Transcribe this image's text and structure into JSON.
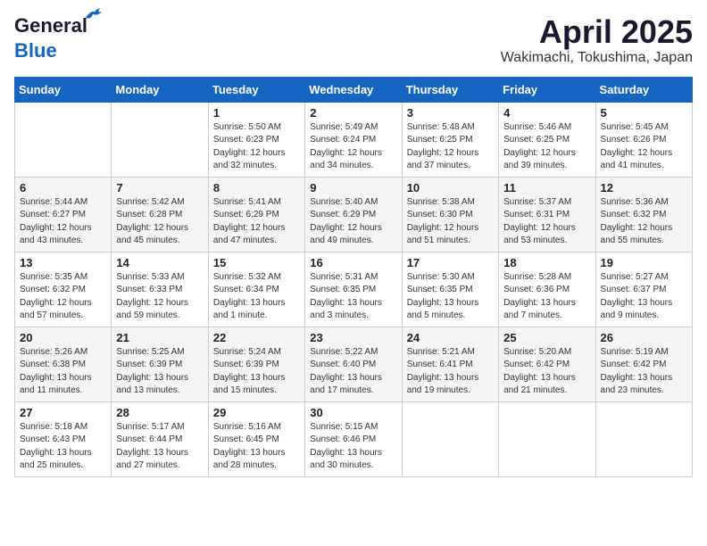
{
  "logo": {
    "line1": "General",
    "line2": "Blue"
  },
  "title": "April 2025",
  "location": "Wakimachi, Tokushima, Japan",
  "weekdays": [
    "Sunday",
    "Monday",
    "Tuesday",
    "Wednesday",
    "Thursday",
    "Friday",
    "Saturday"
  ],
  "weeks": [
    [
      {
        "day": "",
        "info": ""
      },
      {
        "day": "",
        "info": ""
      },
      {
        "day": "1",
        "info": "Sunrise: 5:50 AM\nSunset: 6:23 PM\nDaylight: 12 hours\nand 32 minutes."
      },
      {
        "day": "2",
        "info": "Sunrise: 5:49 AM\nSunset: 6:24 PM\nDaylight: 12 hours\nand 34 minutes."
      },
      {
        "day": "3",
        "info": "Sunrise: 5:48 AM\nSunset: 6:25 PM\nDaylight: 12 hours\nand 37 minutes."
      },
      {
        "day": "4",
        "info": "Sunrise: 5:46 AM\nSunset: 6:25 PM\nDaylight: 12 hours\nand 39 minutes."
      },
      {
        "day": "5",
        "info": "Sunrise: 5:45 AM\nSunset: 6:26 PM\nDaylight: 12 hours\nand 41 minutes."
      }
    ],
    [
      {
        "day": "6",
        "info": "Sunrise: 5:44 AM\nSunset: 6:27 PM\nDaylight: 12 hours\nand 43 minutes."
      },
      {
        "day": "7",
        "info": "Sunrise: 5:42 AM\nSunset: 6:28 PM\nDaylight: 12 hours\nand 45 minutes."
      },
      {
        "day": "8",
        "info": "Sunrise: 5:41 AM\nSunset: 6:29 PM\nDaylight: 12 hours\nand 47 minutes."
      },
      {
        "day": "9",
        "info": "Sunrise: 5:40 AM\nSunset: 6:29 PM\nDaylight: 12 hours\nand 49 minutes."
      },
      {
        "day": "10",
        "info": "Sunrise: 5:38 AM\nSunset: 6:30 PM\nDaylight: 12 hours\nand 51 minutes."
      },
      {
        "day": "11",
        "info": "Sunrise: 5:37 AM\nSunset: 6:31 PM\nDaylight: 12 hours\nand 53 minutes."
      },
      {
        "day": "12",
        "info": "Sunrise: 5:36 AM\nSunset: 6:32 PM\nDaylight: 12 hours\nand 55 minutes."
      }
    ],
    [
      {
        "day": "13",
        "info": "Sunrise: 5:35 AM\nSunset: 6:32 PM\nDaylight: 12 hours\nand 57 minutes."
      },
      {
        "day": "14",
        "info": "Sunrise: 5:33 AM\nSunset: 6:33 PM\nDaylight: 12 hours\nand 59 minutes."
      },
      {
        "day": "15",
        "info": "Sunrise: 5:32 AM\nSunset: 6:34 PM\nDaylight: 13 hours\nand 1 minute."
      },
      {
        "day": "16",
        "info": "Sunrise: 5:31 AM\nSunset: 6:35 PM\nDaylight: 13 hours\nand 3 minutes."
      },
      {
        "day": "17",
        "info": "Sunrise: 5:30 AM\nSunset: 6:35 PM\nDaylight: 13 hours\nand 5 minutes."
      },
      {
        "day": "18",
        "info": "Sunrise: 5:28 AM\nSunset: 6:36 PM\nDaylight: 13 hours\nand 7 minutes."
      },
      {
        "day": "19",
        "info": "Sunrise: 5:27 AM\nSunset: 6:37 PM\nDaylight: 13 hours\nand 9 minutes."
      }
    ],
    [
      {
        "day": "20",
        "info": "Sunrise: 5:26 AM\nSunset: 6:38 PM\nDaylight: 13 hours\nand 11 minutes."
      },
      {
        "day": "21",
        "info": "Sunrise: 5:25 AM\nSunset: 6:39 PM\nDaylight: 13 hours\nand 13 minutes."
      },
      {
        "day": "22",
        "info": "Sunrise: 5:24 AM\nSunset: 6:39 PM\nDaylight: 13 hours\nand 15 minutes."
      },
      {
        "day": "23",
        "info": "Sunrise: 5:22 AM\nSunset: 6:40 PM\nDaylight: 13 hours\nand 17 minutes."
      },
      {
        "day": "24",
        "info": "Sunrise: 5:21 AM\nSunset: 6:41 PM\nDaylight: 13 hours\nand 19 minutes."
      },
      {
        "day": "25",
        "info": "Sunrise: 5:20 AM\nSunset: 6:42 PM\nDaylight: 13 hours\nand 21 minutes."
      },
      {
        "day": "26",
        "info": "Sunrise: 5:19 AM\nSunset: 6:42 PM\nDaylight: 13 hours\nand 23 minutes."
      }
    ],
    [
      {
        "day": "27",
        "info": "Sunrise: 5:18 AM\nSunset: 6:43 PM\nDaylight: 13 hours\nand 25 minutes."
      },
      {
        "day": "28",
        "info": "Sunrise: 5:17 AM\nSunset: 6:44 PM\nDaylight: 13 hours\nand 27 minutes."
      },
      {
        "day": "29",
        "info": "Sunrise: 5:16 AM\nSunset: 6:45 PM\nDaylight: 13 hours\nand 28 minutes."
      },
      {
        "day": "30",
        "info": "Sunrise: 5:15 AM\nSunset: 6:46 PM\nDaylight: 13 hours\nand 30 minutes."
      },
      {
        "day": "",
        "info": ""
      },
      {
        "day": "",
        "info": ""
      },
      {
        "day": "",
        "info": ""
      }
    ]
  ]
}
